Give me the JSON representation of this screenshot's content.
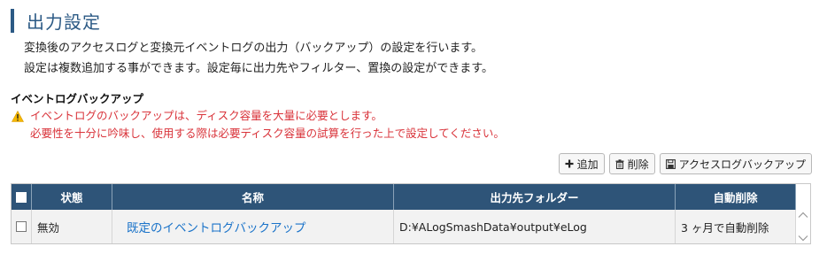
{
  "page": {
    "title": "出力設定",
    "desc1": "変換後のアクセスログと変換元イベントログの出力（バックアップ）の設定を行います。",
    "desc2": "設定は複数追加する事ができます。設定毎に出力先やフィルター、置換の設定ができます。"
  },
  "section": {
    "heading": "イベントログバックアップ",
    "warning1": "イベントログのバックアップは、ディスク容量を大量に必要とします。",
    "warning2": "必要性を十分に吟味し、使用する際は必要ディスク容量の試算を行った上で設定してください。"
  },
  "toolbar": {
    "add_label": "追加",
    "delete_label": "削除",
    "backup_label": "アクセスログバックアップ"
  },
  "table": {
    "headers": {
      "status": "状態",
      "name": "名称",
      "folder": "出力先フォルダー",
      "auto_delete": "自動削除"
    },
    "rows": [
      {
        "status": "無効",
        "name": "既定のイベントログバックアップ",
        "folder": "D:¥ALogSmashData¥output¥eLog",
        "auto_delete": "3 ヶ月で自動削除"
      }
    ]
  },
  "colors": {
    "accent": "#2c5a85",
    "header_bg": "#2e5478",
    "warning": "#d9333a",
    "link": "#1a73c9"
  },
  "icons": {
    "warning": "warning-icon",
    "add": "plus-icon",
    "delete": "trash-icon",
    "save": "floppy-icon"
  }
}
